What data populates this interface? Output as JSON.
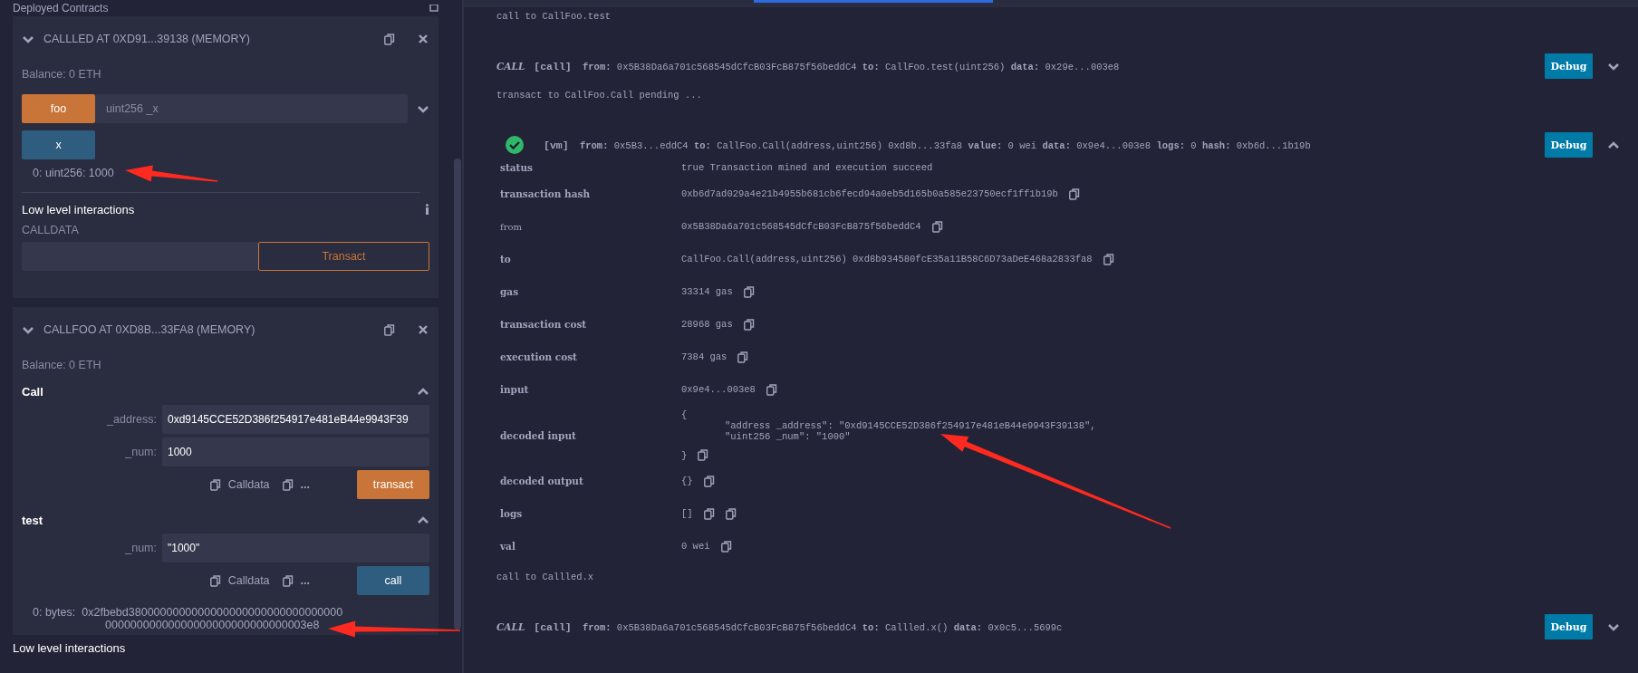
{
  "deploy_panel": {
    "heading": "Deployed Contracts",
    "contracts": [
      {
        "title": "CALLLED AT 0XD91...39138 (MEMORY)",
        "expanded": true,
        "balance": "Balance: 0 ETH",
        "functions": [
          {
            "kind": "setter",
            "name": "foo",
            "placeholder": "uint256 _x"
          },
          {
            "kind": "getter",
            "name": "x"
          }
        ],
        "outputs": [
          "0: uint256: 1000"
        ],
        "low_level": {
          "title": "Low level interactions",
          "calldata_label": "CALLDATA",
          "button": "Transact"
        }
      },
      {
        "title": "CALLFOO AT 0XD8B...33FA8 (MEMORY)",
        "expanded": true,
        "balance": "Balance: 0 ETH",
        "functions": [
          {
            "kind": "setter-form",
            "name": "Call",
            "expanded": true,
            "params": [
              {
                "label": "_address:",
                "value": "0xd9145CCE52D386f254917e481eB44e9943F39"
              },
              {
                "label": "_num:",
                "value": "1000"
              }
            ],
            "calldata": "Calldata",
            "more": "...",
            "button": "transact"
          },
          {
            "kind": "getter-form",
            "name": "test",
            "expanded": true,
            "params": [
              {
                "label": "_num:",
                "value": "\"1000\""
              }
            ],
            "calldata": "Calldata",
            "more": "...",
            "button": "call",
            "output_label": "0:  bytes:",
            "output": "0x2fbebd380000000000000000000000000000000000000000000000000000000000000003e8"
          }
        ]
      }
    ],
    "footer_heading": "Low level interactions"
  },
  "terminal": {
    "entries": [
      {
        "kind": "info",
        "text": "call to CallFoo.test"
      },
      {
        "kind": "call",
        "tag": "CALL",
        "method": "[call]",
        "fields": [
          {
            "key": "from:",
            "value": "0x5B38Da6a701c568545dCfcB03FcB875f56beddC4"
          },
          {
            "key": "to:",
            "value": "CallFoo.test(uint256)"
          },
          {
            "key": "data:",
            "value": "0x29e...003e8"
          }
        ],
        "debug": "Debug",
        "expanded": false
      },
      {
        "kind": "info",
        "text": "transact to CallFoo.Call pending ..."
      },
      {
        "kind": "tx",
        "success": true,
        "method": "[vm]",
        "fields": [
          {
            "key": "from:",
            "value": "0x5B3...eddC4"
          },
          {
            "key": "to:",
            "value": "CallFoo.Call(address,uint256) 0xd8b...33fa8"
          },
          {
            "key": "value:",
            "value": "0 wei"
          },
          {
            "key": "data:",
            "value": "0x9e4...003e8"
          },
          {
            "key": "logs:",
            "value": "0"
          },
          {
            "key": "hash:",
            "value": "0xb6d...1b19b"
          }
        ],
        "debug": "Debug",
        "expanded": true,
        "details": [
          {
            "key": "status",
            "key_bold": true,
            "value": "true Transaction mined and execution succeed"
          },
          {
            "key": "transaction hash",
            "key_bold": true,
            "value": "0xb6d7ad029a4e21b4955b681cb6fecd94a0eb5d165b0a585e23750ecf1ff1b19b",
            "actions": [
              {
                "kind": "copy"
              }
            ]
          },
          {
            "key": "from",
            "key_bold": false,
            "value": "0x5B38Da6a701c568545dCfcB03FcB875f56beddC4",
            "actions": [
              {
                "kind": "copy"
              }
            ]
          },
          {
            "key": "to",
            "key_bold": true,
            "value": "CallFoo.Call(address,uint256) 0xd8b934580fcE35a11B58C6D73aDeE468a2833fa8",
            "actions": [
              {
                "kind": "copy"
              }
            ]
          },
          {
            "key": "gas",
            "key_bold": true,
            "value": "33314 gas",
            "actions": [
              {
                "kind": "copy"
              }
            ]
          },
          {
            "key": "transaction cost",
            "key_bold": true,
            "value": "28968 gas",
            "actions": [
              {
                "kind": "copy"
              }
            ]
          },
          {
            "key": "execution cost",
            "key_bold": true,
            "value": "7384 gas",
            "actions": [
              {
                "kind": "copy"
              }
            ]
          },
          {
            "key": "input",
            "key_bold": true,
            "value": "0x9e4...003e8",
            "actions": [
              {
                "kind": "copy"
              }
            ]
          },
          {
            "key": "decoded input",
            "key_bold": true,
            "open": "{",
            "lines": [
              "\"address _address\": \"0xd9145CCE52D386f254917e481eB44e9943F39138\",",
              "\"uint256 _num\": \"1000\""
            ],
            "close": "}",
            "actions": [
              {
                "kind": "copy"
              }
            ]
          },
          {
            "key": "decoded output",
            "key_bold": true,
            "value": "{}",
            "actions": [
              {
                "kind": "copy"
              }
            ]
          },
          {
            "key": "logs",
            "key_bold": true,
            "value": "[]",
            "actions": [
              {
                "kind": "copy"
              },
              {
                "kind": "copy"
              }
            ]
          },
          {
            "key": "val",
            "key_bold": true,
            "value": "0 wei",
            "actions": [
              {
                "kind": "copy"
              }
            ]
          }
        ]
      },
      {
        "kind": "info",
        "text": "call to Callled.x"
      },
      {
        "kind": "call",
        "tag": "CALL",
        "method": "[call]",
        "fields": [
          {
            "key": "from:",
            "value": "0x5B38Da6a701c568545dCfcB03FcB875f56beddC4"
          },
          {
            "key": "to:",
            "value": "Callled.x()"
          },
          {
            "key": "data:",
            "value": "0x0c5...5699c"
          }
        ],
        "debug": "Debug",
        "expanded": false
      }
    ]
  }
}
